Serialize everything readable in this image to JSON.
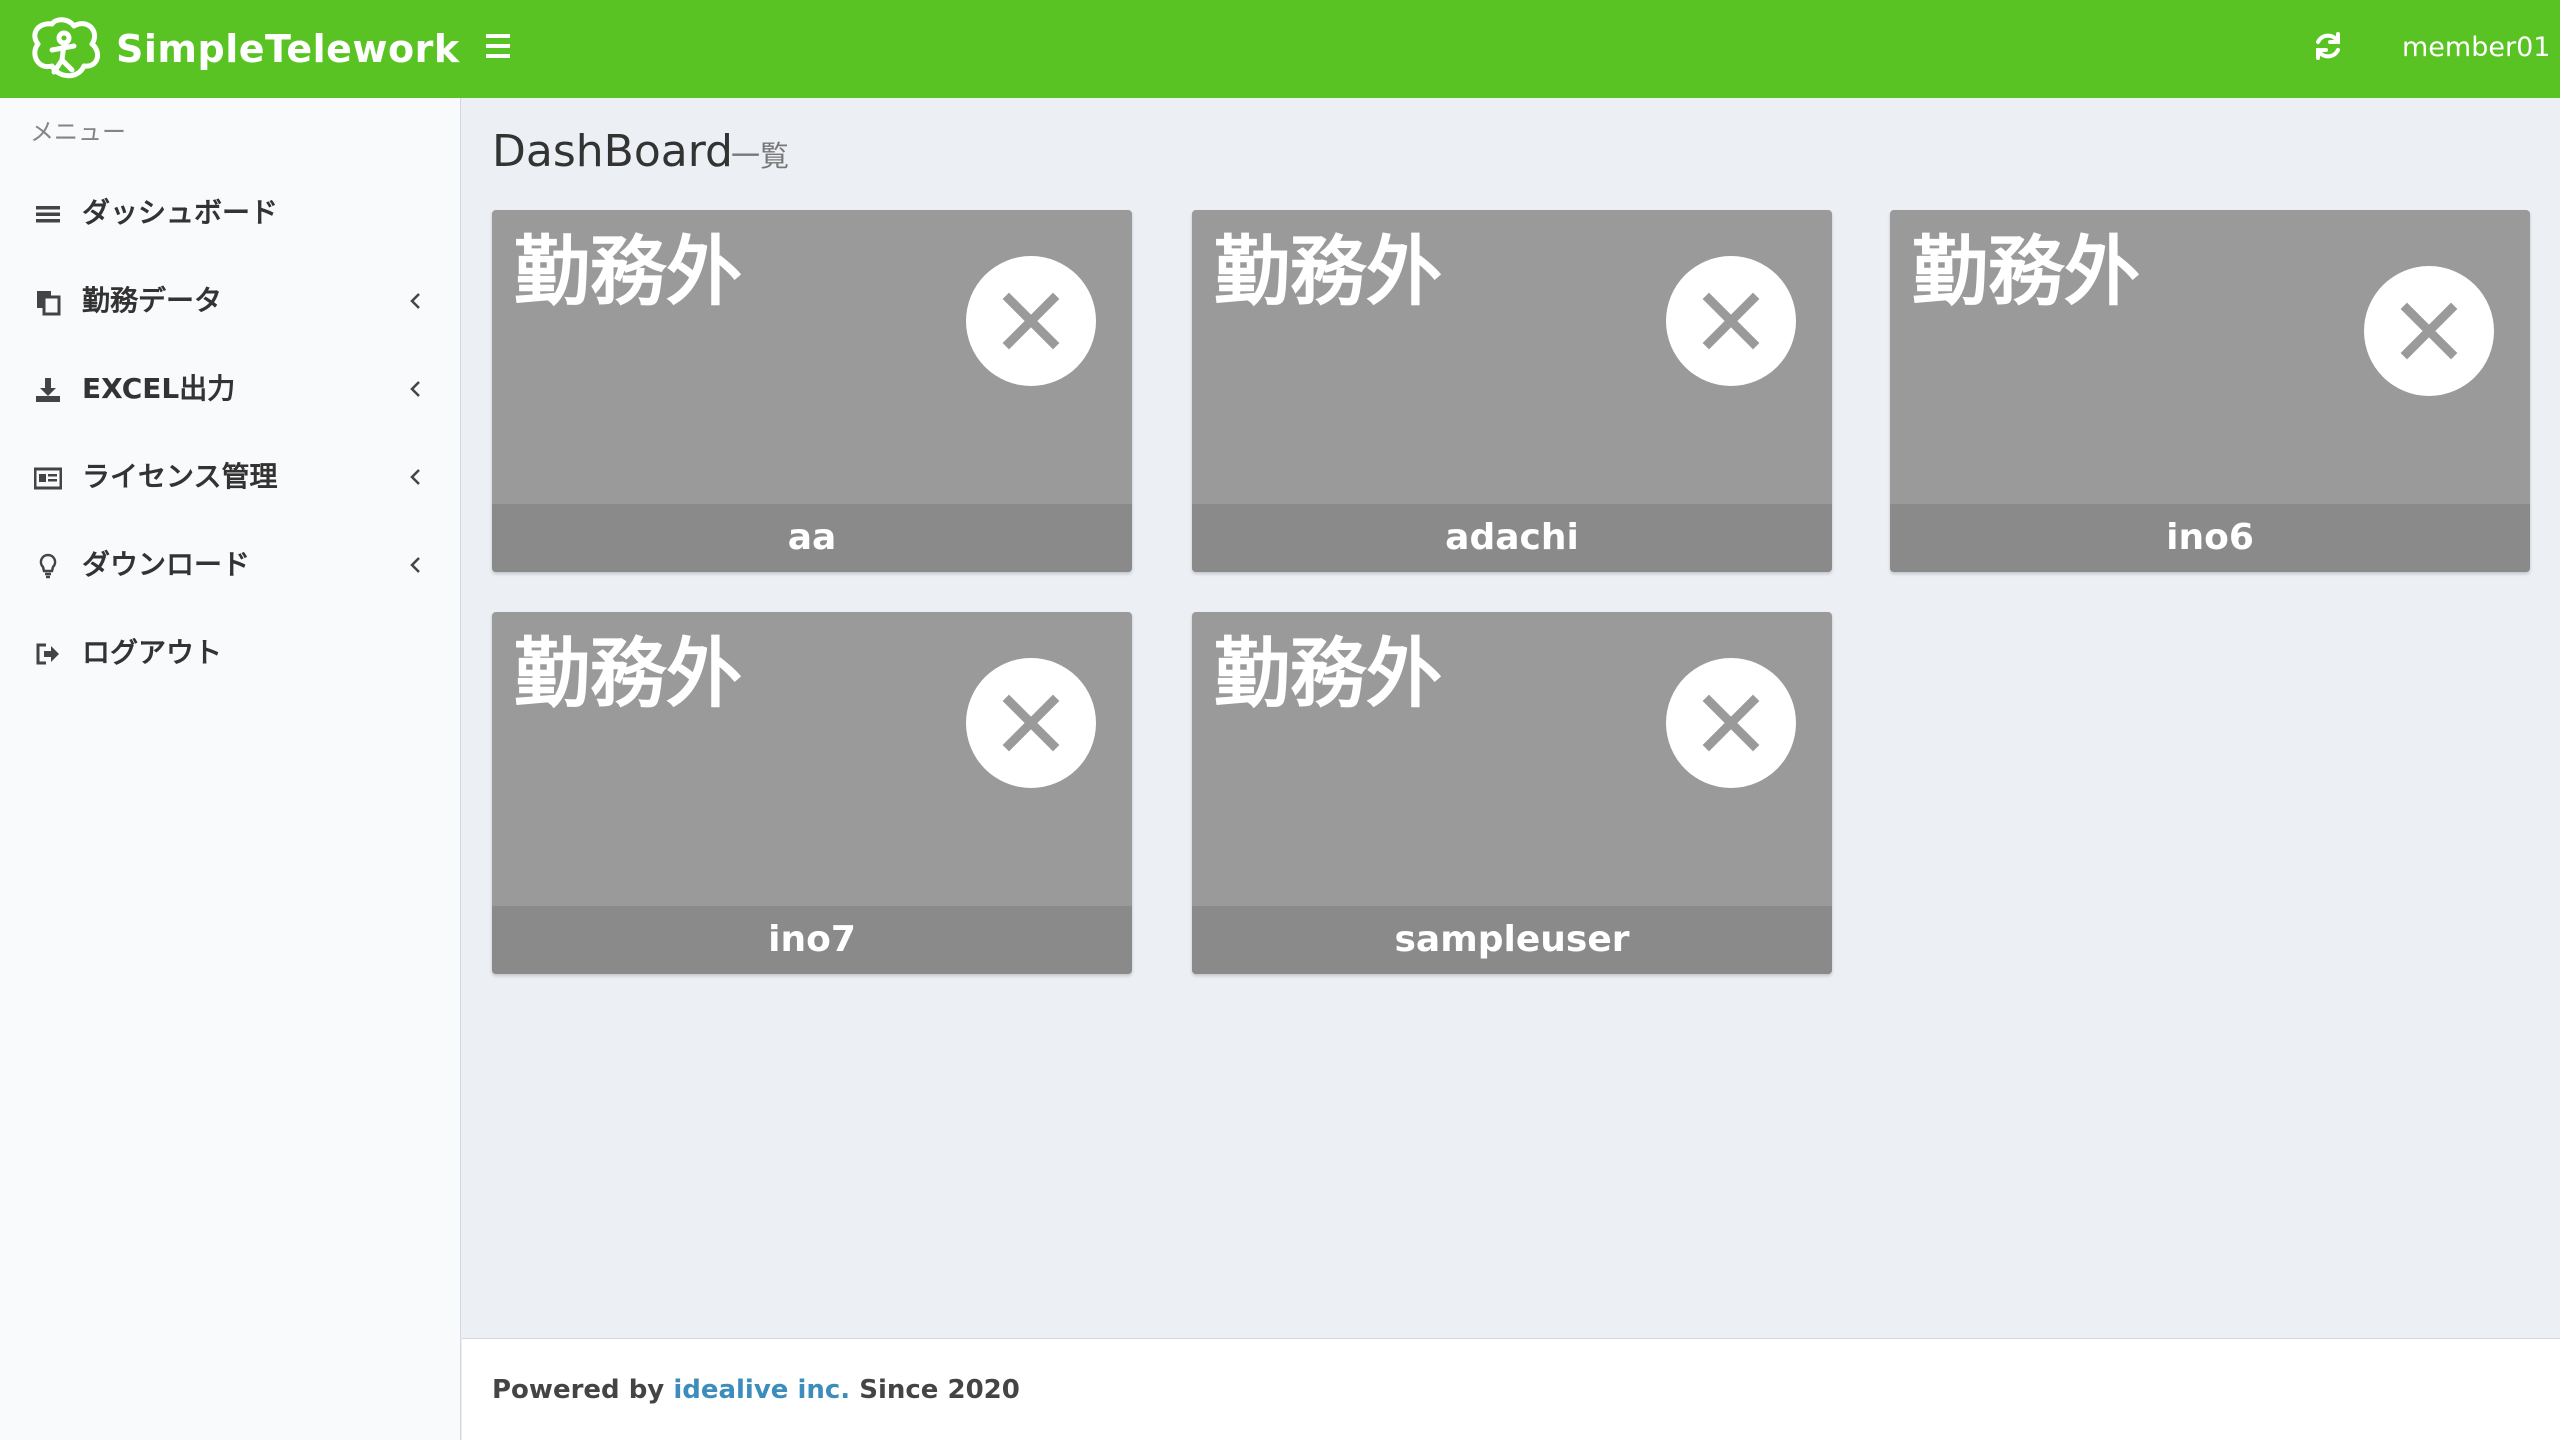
{
  "header": {
    "brand": "SimpleTelework",
    "username": "member01",
    "colors": {
      "bar": "#5ac324",
      "text": "#ffffff"
    },
    "icons": {
      "logo": "simpletelework-logo-icon",
      "menu_toggle": "hamburger-icon",
      "refresh": "refresh-icon"
    }
  },
  "sidebar": {
    "header": "メニュー",
    "items": [
      {
        "label": "ダッシュボード",
        "icon": "list-icon",
        "has_submenu": false
      },
      {
        "label": "勤務データ",
        "icon": "copy-icon",
        "has_submenu": true
      },
      {
        "label": "EXCEL出力",
        "icon": "download-icon",
        "has_submenu": true
      },
      {
        "label": "ライセンス管理",
        "icon": "id-card-icon",
        "has_submenu": true
      },
      {
        "label": "ダウンロード",
        "icon": "lightbulb-icon",
        "has_submenu": true
      },
      {
        "label": "ログアウト",
        "icon": "sign-out-icon",
        "has_submenu": false
      }
    ]
  },
  "page": {
    "title": "DashBoard",
    "subtitle": "一覧"
  },
  "cards": [
    {
      "status": "勤務外",
      "user": "aa",
      "icon": "close-icon"
    },
    {
      "status": "勤務外",
      "user": "adachi",
      "icon": "close-icon"
    },
    {
      "status": "勤務外",
      "user": "ino6",
      "icon": "close-icon"
    },
    {
      "status": "勤務外",
      "user": "ino7",
      "icon": "close-icon"
    },
    {
      "status": "勤務外",
      "user": "sampleuser",
      "icon": "close-icon"
    }
  ],
  "card_colors": {
    "body": "#9a9a9a",
    "footer": "#8a8a8a",
    "text": "#ffffff"
  },
  "footer": {
    "prefix": "Powered by ",
    "company": "idealive inc.",
    "suffix": " Since 2020",
    "link_color": "#3c8dbc"
  }
}
